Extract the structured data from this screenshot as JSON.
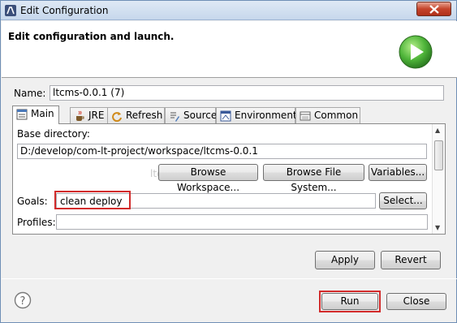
{
  "window": {
    "title": "Edit Configuration",
    "close_icon": "close-x-icon"
  },
  "header": {
    "title": "Edit configuration and launch.",
    "icon": "run-launch-icon"
  },
  "name": {
    "label": "Name:",
    "value": "ltcms-0.0.1 (7)"
  },
  "tabs": [
    {
      "label": "Main",
      "icon": "main-tab-icon",
      "active": true
    },
    {
      "label": "JRE",
      "icon": "jre-icon"
    },
    {
      "label": "Refresh",
      "icon": "refresh-icon"
    },
    {
      "label": "Source",
      "icon": "source-icon"
    },
    {
      "label": "Environment",
      "icon": "environment-icon"
    },
    {
      "label": "Common",
      "icon": "common-icon"
    }
  ],
  "main": {
    "base_directory_label": "Base directory:",
    "base_directory_value": "D:/develop/com-lt-project/workspace/ltcms-0.0.1",
    "ghost_text": "ltcms",
    "browse_workspace": "Browse Workspace...",
    "browse_file_system": "Browse File System...",
    "variables": "Variables...",
    "goals_label": "Goals:",
    "goals_value": "clean deploy",
    "select": "Select...",
    "profiles_label": "Profiles:",
    "profiles_value": ""
  },
  "actions": {
    "apply": "Apply",
    "revert": "Revert"
  },
  "footer": {
    "run": "Run",
    "close": "Close",
    "help_icon": "help-icon"
  },
  "colors": {
    "highlight": "#d22b2b",
    "run_icon": "#3fa33a"
  }
}
